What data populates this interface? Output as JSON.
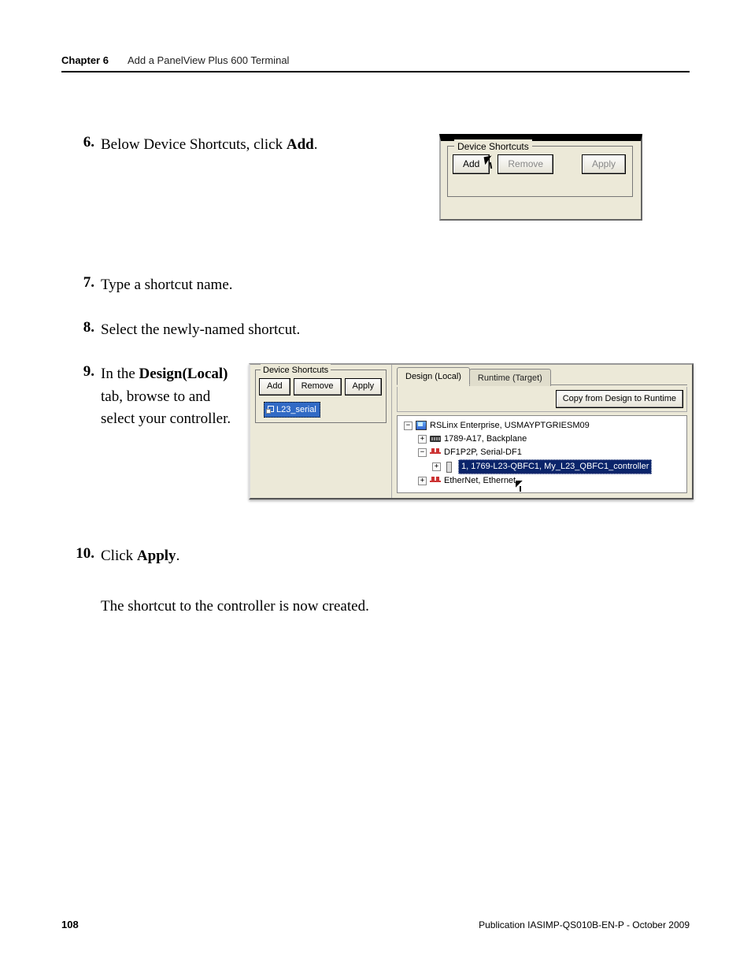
{
  "header": {
    "chapter_label": "Chapter 6",
    "chapter_title": "Add a PanelView Plus 600 Terminal"
  },
  "steps": {
    "s6": {
      "num": "6.",
      "text_before": "Below Device Shortcuts, click ",
      "bold": "Add",
      "text_after": "."
    },
    "s7": {
      "num": "7.",
      "text": "Type a shortcut name."
    },
    "s8": {
      "num": "8.",
      "text": "Select the newly-named shortcut."
    },
    "s9": {
      "num": "9.",
      "line1_before": "In the ",
      "line1_bold": "Design(Local)",
      "rest": " tab, browse to and select your controller."
    },
    "s10": {
      "num": "10.",
      "text_before": "Click ",
      "bold": "Apply",
      "text_after": "."
    },
    "followup": "The shortcut to the controller is now created."
  },
  "panel1": {
    "legend": "Device Shortcuts",
    "add": "Add",
    "remove": "Remove",
    "apply": "Apply"
  },
  "panel2": {
    "left": {
      "legend": "Device Shortcuts",
      "add": "Add",
      "remove": "Remove",
      "apply": "Apply",
      "shortcut_name": "L23_serial"
    },
    "right": {
      "tab_active": "Design (Local)",
      "tab_inactive": "Runtime (Target)",
      "copy_btn": "Copy from Design to Runtime",
      "tree": {
        "root": "RSLinx Enterprise, USMAYPTGRIESM09",
        "n1": "1789-A17, Backplane",
        "n2": "DF1P2P, Serial-DF1",
        "n3": "1, 1769-L23-QBFC1, My_L23_QBFC1_controller",
        "n4": "EtherNet, Ethernet"
      }
    }
  },
  "footer": {
    "page": "108",
    "pub": "Publication IASIMP-QS010B-EN-P - October 2009"
  }
}
